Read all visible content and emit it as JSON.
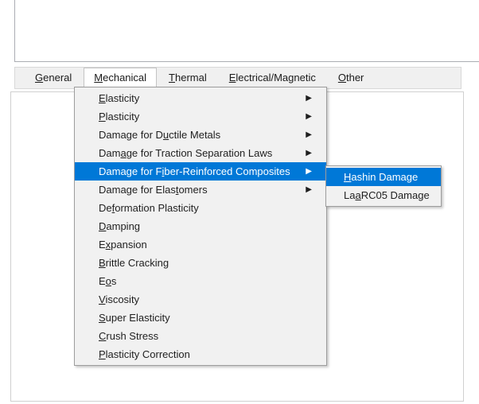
{
  "window": {
    "top_panel_label": "",
    "content_panel_label": ""
  },
  "colors": {
    "accent": "#0078d7",
    "menu_bg": "#f1f1f1",
    "menu_border": "#9d9d9d",
    "tabstrip_bg": "#f0f0f0",
    "text": "#1f1f1f",
    "highlight_text": "#ffffff"
  },
  "tabs": [
    {
      "id": "general",
      "label": "General",
      "mnemonic": "G",
      "selected": false
    },
    {
      "id": "mechanical",
      "label": "Mechanical",
      "mnemonic": "M",
      "selected": true
    },
    {
      "id": "thermal",
      "label": "Thermal",
      "mnemonic": "T",
      "selected": false
    },
    {
      "id": "electrical-magnetic",
      "label": "Electrical/Magnetic",
      "mnemonic": "E",
      "selected": false
    },
    {
      "id": "other",
      "label": "Other",
      "mnemonic": "O",
      "selected": false
    }
  ],
  "mechanical_menu": {
    "arrow_glyph": "▶",
    "items": [
      {
        "id": "elasticity",
        "pre": "",
        "mnemonic": "E",
        "post": "lasticity",
        "has_submenu": true,
        "highlighted": false
      },
      {
        "id": "plasticity",
        "pre": "",
        "mnemonic": "P",
        "post": "lasticity",
        "has_submenu": true,
        "highlighted": false
      },
      {
        "id": "damage-ductile-metals",
        "pre": "Damage for D",
        "mnemonic": "u",
        "post": "ctile Metals",
        "has_submenu": true,
        "highlighted": false
      },
      {
        "id": "damage-traction-separation-laws",
        "pre": "Dam",
        "mnemonic": "a",
        "post": "ge for Traction Separation Laws",
        "has_submenu": true,
        "highlighted": false
      },
      {
        "id": "damage-fiber-reinforced-composites",
        "pre": "Damage for F",
        "mnemonic": "i",
        "post": "ber-Reinforced Composites",
        "has_submenu": true,
        "highlighted": true
      },
      {
        "id": "damage-elastomers",
        "pre": "Damage for Elas",
        "mnemonic": "t",
        "post": "omers",
        "has_submenu": true,
        "highlighted": false
      },
      {
        "id": "deformation-plasticity",
        "pre": "De",
        "mnemonic": "f",
        "post": "ormation Plasticity",
        "has_submenu": false,
        "highlighted": false
      },
      {
        "id": "damping",
        "pre": "",
        "mnemonic": "D",
        "post": "amping",
        "has_submenu": false,
        "highlighted": false
      },
      {
        "id": "expansion",
        "pre": "E",
        "mnemonic": "x",
        "post": "pansion",
        "has_submenu": false,
        "highlighted": false
      },
      {
        "id": "brittle-cracking",
        "pre": "",
        "mnemonic": "B",
        "post": "rittle Cracking",
        "has_submenu": false,
        "highlighted": false
      },
      {
        "id": "eos",
        "pre": "E",
        "mnemonic": "o",
        "post": "s",
        "has_submenu": false,
        "highlighted": false
      },
      {
        "id": "viscosity",
        "pre": "",
        "mnemonic": "V",
        "post": "iscosity",
        "has_submenu": false,
        "highlighted": false
      },
      {
        "id": "super-elasticity",
        "pre": "",
        "mnemonic": "S",
        "post": "uper Elasticity",
        "has_submenu": false,
        "highlighted": false
      },
      {
        "id": "crush-stress",
        "pre": "",
        "mnemonic": "C",
        "post": "rush Stress",
        "has_submenu": false,
        "highlighted": false
      },
      {
        "id": "plasticity-correction",
        "pre": "",
        "mnemonic": "P",
        "post": "lasticity Correction",
        "has_submenu": false,
        "highlighted": false
      }
    ]
  },
  "composites_submenu": {
    "items": [
      {
        "id": "hashin-damage",
        "pre": "",
        "mnemonic": "H",
        "post": "ashin Damage",
        "highlighted": true
      },
      {
        "id": "larc05-damage",
        "pre": "La",
        "mnemonic": "a",
        "post": "RC05 Damage",
        "highlighted": false
      }
    ]
  }
}
